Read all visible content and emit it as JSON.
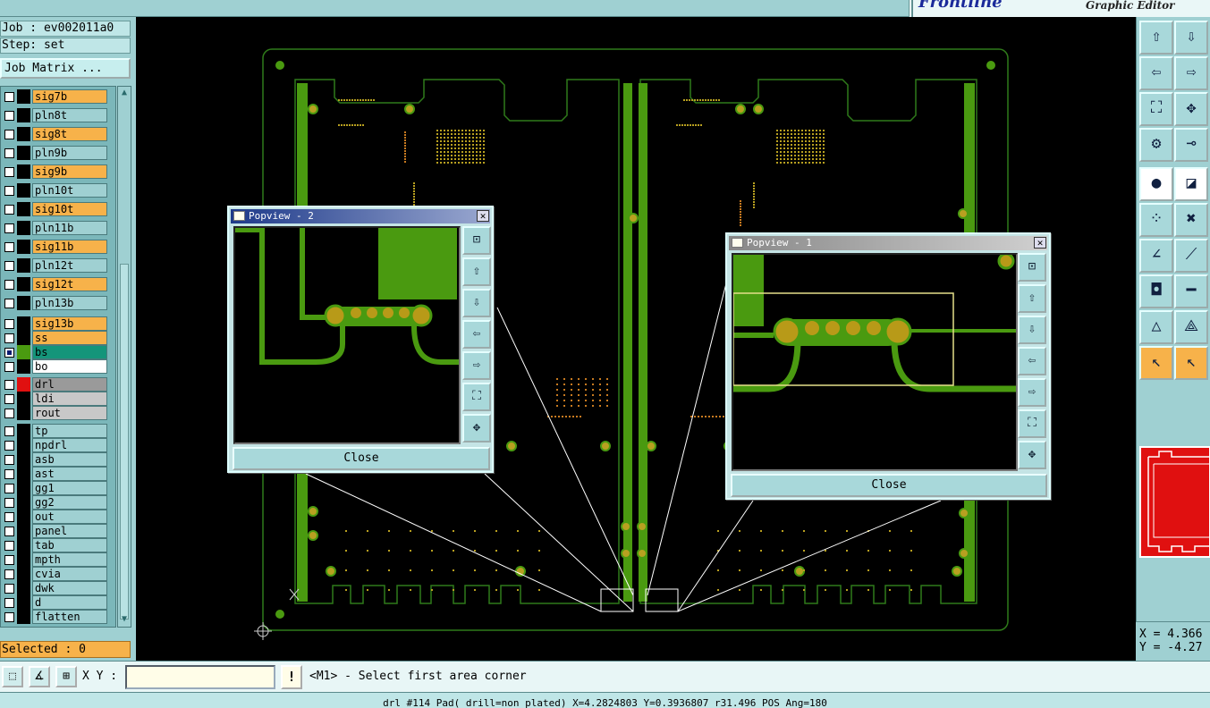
{
  "app": {
    "brand_prefix": "",
    "brand_main": "Frontline",
    "subtitle": "Graphic Editor"
  },
  "job": {
    "job_text": "Job : ev002011a0",
    "step_text": "Step: set",
    "matrix_button": "Job Matrix ..."
  },
  "layers": [
    {
      "name": "sig7b",
      "bg": "#f7b24a",
      "swatch": "#000000",
      "checked": false
    },
    {
      "name": "pln8t",
      "bg": "#9fd0d2",
      "swatch": "#000000",
      "checked": false
    },
    {
      "name": "sig8t",
      "bg": "#f7b24a",
      "swatch": "#000000",
      "checked": false
    },
    {
      "name": "pln9b",
      "bg": "#9fd0d2",
      "swatch": "#000000",
      "checked": false
    },
    {
      "name": "sig9b",
      "bg": "#f7b24a",
      "swatch": "#000000",
      "checked": false
    },
    {
      "name": "pln10t",
      "bg": "#9fd0d2",
      "swatch": "#000000",
      "checked": false
    },
    {
      "name": "sig10t",
      "bg": "#f7b24a",
      "swatch": "#000000",
      "checked": false
    },
    {
      "name": "pln11b",
      "bg": "#9fd0d2",
      "swatch": "#000000",
      "checked": false
    },
    {
      "name": "sig11b",
      "bg": "#f7b24a",
      "swatch": "#000000",
      "checked": false
    },
    {
      "name": "pln12t",
      "bg": "#9fd0d2",
      "swatch": "#000000",
      "checked": false
    },
    {
      "name": "sig12t",
      "bg": "#f7b24a",
      "swatch": "#000000",
      "checked": false
    },
    {
      "name": "pln13b",
      "bg": "#9fd0d2",
      "swatch": "#000000",
      "checked": false
    },
    {
      "name": "sig13b",
      "bg": "#f7b24a",
      "swatch": "#000000",
      "checked": false
    },
    {
      "name": "ss",
      "bg": "#f7b24a",
      "swatch": "#000000",
      "checked": false
    },
    {
      "name": "bs",
      "bg": "#14957a",
      "swatch": "#4a9a10",
      "checked": true
    },
    {
      "name": "bo",
      "bg": "#ffffff",
      "swatch": "#000000",
      "checked": false
    },
    {
      "name": "drl",
      "bg": "#9a9a9a",
      "swatch": "#e01010",
      "checked": false
    },
    {
      "name": "ldi",
      "bg": "#c8c8c8",
      "swatch": "#000000",
      "checked": false
    },
    {
      "name": "rout",
      "bg": "#c8c8c8",
      "swatch": "#000000",
      "checked": false
    },
    {
      "name": "tp",
      "bg": "#9fd0d2",
      "swatch": "#000000",
      "checked": false
    },
    {
      "name": "npdrl",
      "bg": "#9fd0d2",
      "swatch": "#000000",
      "checked": false
    },
    {
      "name": "asb",
      "bg": "#9fd0d2",
      "swatch": "#000000",
      "checked": false
    },
    {
      "name": "ast",
      "bg": "#9fd0d2",
      "swatch": "#000000",
      "checked": false
    },
    {
      "name": "gg1",
      "bg": "#9fd0d2",
      "swatch": "#000000",
      "checked": false
    },
    {
      "name": "gg2",
      "bg": "#9fd0d2",
      "swatch": "#000000",
      "checked": false
    },
    {
      "name": "out",
      "bg": "#9fd0d2",
      "swatch": "#000000",
      "checked": false
    },
    {
      "name": "panel",
      "bg": "#9fd0d2",
      "swatch": "#000000",
      "checked": false
    },
    {
      "name": "tab",
      "bg": "#9fd0d2",
      "swatch": "#000000",
      "checked": false
    },
    {
      "name": "mpth",
      "bg": "#9fd0d2",
      "swatch": "#000000",
      "checked": false
    },
    {
      "name": "cvia",
      "bg": "#9fd0d2",
      "swatch": "#000000",
      "checked": false
    },
    {
      "name": "dwk",
      "bg": "#9fd0d2",
      "swatch": "#000000",
      "checked": false
    },
    {
      "name": "d",
      "bg": "#9fd0d2",
      "swatch": "#000000",
      "checked": false
    },
    {
      "name": "flatten",
      "bg": "#9fd0d2",
      "swatch": "#000000",
      "checked": false
    }
  ],
  "selected": "Selected : 0",
  "popview2": {
    "title": "Popview - 2",
    "close": "Close"
  },
  "popview1": {
    "title": "Popview - 1",
    "close": "Close"
  },
  "coords": {
    "x": "X = 4.366",
    "y": "Y = -4.27"
  },
  "bottom": {
    "xy_label": "X Y :",
    "xy_value": "",
    "warn": "!",
    "prompt": "<M1> - Select first area corner"
  },
  "status_line": "drl #114 Pad( drill=non_plated) X=4.2824803 Y=0.3936807 r31.496 POS Ang=180",
  "colors": {
    "pcb_green": "#4a9a10",
    "outline": "#2f7a1a",
    "pad": "#b8a020",
    "drill_dots": "#c87a20",
    "panel_red": "#e01010"
  },
  "icons": {
    "right_toolbar": [
      "zoom-in-icon",
      "zoom-out-icon",
      "pan-left-icon",
      "pan-right-icon",
      "fit-icon",
      "zoom-home-icon",
      "snap-icon",
      "measure-icon",
      "display-icon",
      "highlight-icon",
      "net-icon",
      "cross-icon",
      "select-line-icon",
      "draw-line-icon",
      "feature-icon",
      "delete-icon",
      "triangle-icon",
      "triangle2-icon",
      "pointer-icon",
      "pointer2-icon"
    ]
  }
}
